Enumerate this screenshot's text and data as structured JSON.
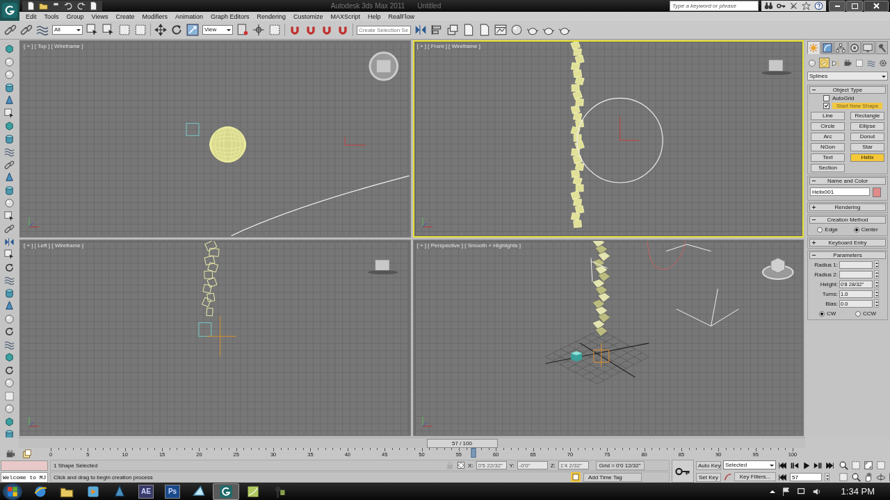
{
  "window": {
    "title": "Autodesk 3ds Max 2011",
    "document": "Untitled"
  },
  "search": {
    "placeholder": "Type a keyword or phrase"
  },
  "menu": [
    "Edit",
    "Tools",
    "Group",
    "Views",
    "Create",
    "Modifiers",
    "Animation",
    "Graph Editors",
    "Rendering",
    "Customize",
    "MAXScript",
    "Help",
    "RealFlow"
  ],
  "toolbar": {
    "selection_filter": "All",
    "reference_coord": "View",
    "named_selection": {
      "placeholder": "Create Selection Se"
    }
  },
  "viewports": [
    {
      "kind": "top",
      "label": "[ + ] [ Top ] [ Wireframe ]",
      "selected": false
    },
    {
      "kind": "front",
      "label": "[ + ] [ Front ] [ Wireframe ]",
      "selected": true
    },
    {
      "kind": "left",
      "label": "[ + ] [ Left ] [ Wireframe ]",
      "selected": false
    },
    {
      "kind": "perspective",
      "label": "[ + ] [ Perspective ] [ Smooth + Highlights ]",
      "selected": false
    }
  ],
  "command_panel": {
    "tabs": [
      {
        "kind": "create",
        "selected": true
      },
      {
        "kind": "modify",
        "selected": false
      },
      {
        "kind": "hierarchy",
        "selected": false
      },
      {
        "kind": "motion",
        "selected": false
      },
      {
        "kind": "display",
        "selected": false
      },
      {
        "kind": "utilities",
        "selected": false
      }
    ],
    "categories": [
      {
        "kind": "geometry",
        "selected": false
      },
      {
        "kind": "shapes",
        "selected": true
      },
      {
        "kind": "lights",
        "selected": false
      },
      {
        "kind": "cameras",
        "selected": false
      },
      {
        "kind": "helpers",
        "selected": false
      },
      {
        "kind": "space_warps",
        "selected": false
      },
      {
        "kind": "systems",
        "selected": false
      }
    ],
    "subcategory": "Splines",
    "rollouts": [
      {
        "kind": "object_type",
        "title": "Object Type",
        "expanded": true,
        "autogrid": {
          "label": "AutoGrid",
          "checked": false
        },
        "start_new_shape": {
          "label": "Start New Shape",
          "checked": true
        },
        "buttons": [
          {
            "label": "Line",
            "selected": false
          },
          {
            "label": "Rectangle",
            "selected": false
          },
          {
            "label": "Circle",
            "selected": false
          },
          {
            "label": "Ellipse",
            "selected": false
          },
          {
            "label": "Arc",
            "selected": false
          },
          {
            "label": "Donut",
            "selected": false
          },
          {
            "label": "NGon",
            "selected": false
          },
          {
            "label": "Star",
            "selected": false
          },
          {
            "label": "Text",
            "selected": false
          },
          {
            "label": "Helix",
            "selected": true
          },
          {
            "label": "Section",
            "selected": false
          }
        ]
      },
      {
        "kind": "name_and_color",
        "title": "Name and Color",
        "expanded": true,
        "name": "Helix001",
        "color": "#e08a8a"
      },
      {
        "title": "Rendering",
        "expanded": false
      },
      {
        "kind": "creation_method",
        "title": "Creation Method",
        "expanded": true,
        "options": [
          {
            "label": "Edge",
            "selected": false
          },
          {
            "label": "Center",
            "selected": true
          }
        ]
      },
      {
        "title": "Keyboard Entry",
        "expanded": false
      },
      {
        "kind": "parameters",
        "title": "Parameters",
        "expanded": true,
        "fields": [
          {
            "label": "Radius 1:"
          },
          {
            "label": "Radius 2:"
          },
          {
            "label": "Height:",
            "value": "0'8 28/32\""
          },
          {
            "label": "Turns:",
            "value": "1.0"
          },
          {
            "label": "Bias:",
            "value": "0.0"
          }
        ],
        "direction": [
          {
            "label": "CW",
            "selected": true
          },
          {
            "label": "CCW",
            "selected": false
          }
        ]
      }
    ]
  },
  "timeline": {
    "position": "57 / 100",
    "level": 0.57,
    "ticks": [
      "0",
      "5",
      "10",
      "15",
      "20",
      "25",
      "30",
      "35",
      "40",
      "45",
      "50",
      "55",
      "60",
      "65",
      "70",
      "75",
      "80",
      "85",
      "90",
      "95",
      "100"
    ]
  },
  "status": {
    "listener": "Welcome to MJ",
    "selection": "1 Shape Selected",
    "prompt": "Click and drag to begin creation process",
    "x": {
      "label": "X:",
      "value": "0'5 22/32\""
    },
    "y": {
      "label": "Y:",
      "value": "-0'0\""
    },
    "z": {
      "label": "Z:",
      "value": "1'4 2/32\""
    },
    "grid": "Grid = 0'0 12/32\"",
    "add_time_tag": "Add Time Tag",
    "auto_key": "Auto Key",
    "set_key": "Set Key",
    "key_mode": "Selected",
    "key_filters": "Key Filters...",
    "frame": "57"
  },
  "taskbar": {
    "items": [
      {
        "kind": "browser",
        "selected": false
      },
      {
        "kind": "folder",
        "selected": false
      },
      {
        "kind": "media",
        "selected": false
      },
      {
        "kind": "cone",
        "selected": false
      },
      {
        "kind": "after_effects",
        "label": "AE",
        "selected": false
      },
      {
        "kind": "photoshop",
        "label": "Ps",
        "selected": false
      },
      {
        "kind": "paper",
        "selected": false
      },
      {
        "kind": "max",
        "selected": true
      },
      {
        "kind": "notes",
        "selected": false
      },
      {
        "kind": "tool",
        "selected": false
      }
    ],
    "clock": "1:34 PM"
  }
}
